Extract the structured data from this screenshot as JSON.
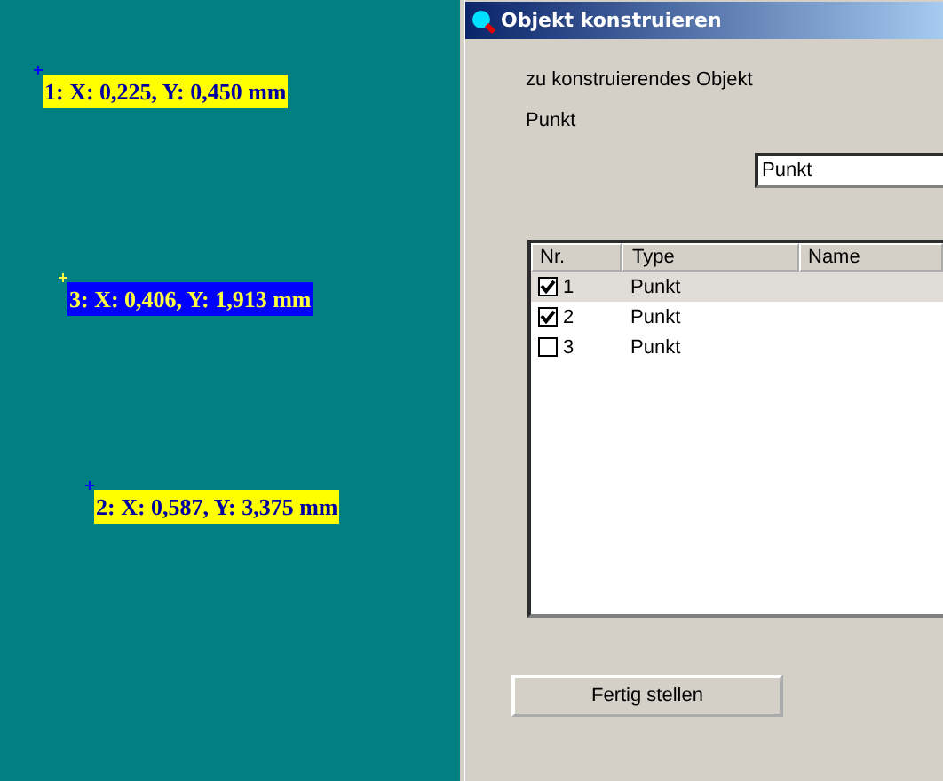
{
  "canvas": {
    "points": [
      {
        "label": "1: X: 0,225, Y: 0,450 mm",
        "selected": false
      },
      {
        "label": "3: X: 0,406, Y: 1,913 mm",
        "selected": true
      },
      {
        "label": "2: X: 0,587, Y: 3,375 mm",
        "selected": false
      }
    ]
  },
  "dialog": {
    "title": "Objekt konstruieren",
    "prompt": "zu konstruierendes Objekt",
    "object_type": "Punkt",
    "name_field": {
      "value": "Punkt"
    },
    "table": {
      "columns": [
        "Nr.",
        "Type",
        "Name"
      ],
      "rows": [
        {
          "nr": "1",
          "type": "Punkt",
          "checked": true,
          "selected": true
        },
        {
          "nr": "2",
          "type": "Punkt",
          "checked": true,
          "selected": false
        },
        {
          "nr": "3",
          "type": "Punkt",
          "checked": false,
          "selected": false
        }
      ]
    },
    "buttons": [
      "Fertig stellen"
    ]
  }
}
